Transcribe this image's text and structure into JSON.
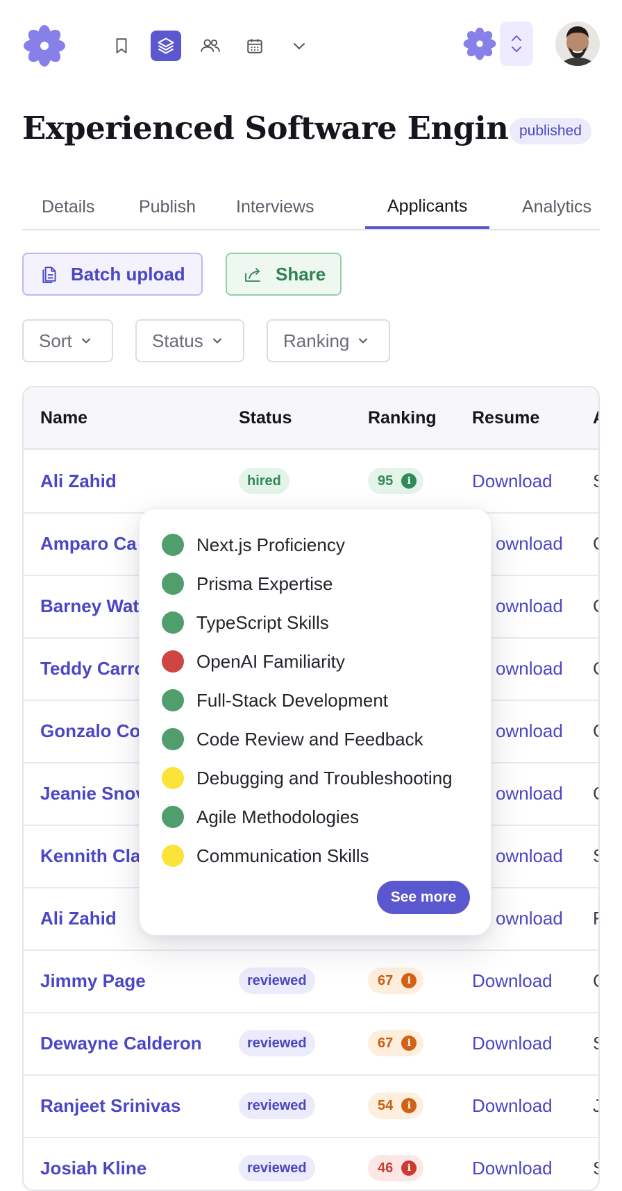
{
  "header": {
    "icons": [
      "flower-logo",
      "bookmark-icon",
      "layers-icon",
      "users-icon",
      "calendar-icon",
      "chevron-down-icon"
    ],
    "avatar_alt": "user avatar"
  },
  "job": {
    "title": "Experienced Software Engine…",
    "status": "published"
  },
  "tabs": [
    {
      "label": "Details"
    },
    {
      "label": "Publish"
    },
    {
      "label": "Interviews"
    },
    {
      "label": "Applicants",
      "active": true
    },
    {
      "label": "Analytics"
    }
  ],
  "actions": {
    "batch_upload": "Batch upload",
    "share": "Share"
  },
  "filters": {
    "sort": "Sort",
    "status": "Status",
    "ranking": "Ranking"
  },
  "table": {
    "columns": [
      "Name",
      "Status",
      "Ranking",
      "Resume",
      "A"
    ],
    "rows": [
      {
        "name": "Ali Zahid",
        "status": "hired",
        "ranking": "95",
        "rank_level": "green",
        "resume": "Download",
        "extra": "S"
      },
      {
        "name": "Amparo Ca",
        "status": "",
        "ranking": "",
        "resume": "ownload",
        "extra": "C"
      },
      {
        "name": "Barney Wat",
        "status": "",
        "ranking": "",
        "resume": "ownload",
        "extra": "C"
      },
      {
        "name": "Teddy Carro",
        "status": "",
        "ranking": "",
        "resume": "ownload",
        "extra": "C"
      },
      {
        "name": "Gonzalo Co",
        "status": "",
        "ranking": "",
        "resume": "ownload",
        "extra": "C"
      },
      {
        "name": "Jeanie Snov",
        "status": "",
        "ranking": "",
        "resume": "ownload",
        "extra": "C"
      },
      {
        "name": "Kennith Cla",
        "status": "",
        "ranking": "",
        "resume": "ownload",
        "extra": "S"
      },
      {
        "name": "Ali Zahid",
        "status": "",
        "ranking": "",
        "resume": "ownload",
        "extra": "F"
      },
      {
        "name": "Jimmy Page",
        "status": "reviewed",
        "ranking": "67",
        "rank_level": "orange",
        "resume": "Download",
        "extra": "C"
      },
      {
        "name": "Dewayne Calderon",
        "status": "reviewed",
        "ranking": "67",
        "rank_level": "orange",
        "resume": "Download",
        "extra": "S"
      },
      {
        "name": "Ranjeet Srinivas",
        "status": "reviewed",
        "ranking": "54",
        "rank_level": "orange",
        "resume": "Download",
        "extra": "J"
      },
      {
        "name": "Josiah Kline",
        "status": "reviewed",
        "ranking": "46",
        "rank_level": "red",
        "resume": "Download",
        "extra": "S"
      }
    ]
  },
  "skills_popover": {
    "skills": [
      {
        "label": "Next.js Proficiency",
        "level": "green"
      },
      {
        "label": "Prisma Expertise",
        "level": "green"
      },
      {
        "label": "TypeScript Skills",
        "level": "green"
      },
      {
        "label": "OpenAI Familiarity",
        "level": "red"
      },
      {
        "label": "Full-Stack Development",
        "level": "green"
      },
      {
        "label": "Code Review and Feedback",
        "level": "green"
      },
      {
        "label": "Debugging and Troubleshooting",
        "level": "yellow"
      },
      {
        "label": "Agile Methodologies",
        "level": "green"
      },
      {
        "label": "Communication Skills",
        "level": "yellow"
      }
    ],
    "see_more": "See more"
  },
  "colors": {
    "accent": "#5b57cf",
    "link": "#4b47c4",
    "success": "#2f8a55",
    "warning": "#d26114",
    "danger": "#cc3a31",
    "skill_yellow": "#fbe33a"
  }
}
